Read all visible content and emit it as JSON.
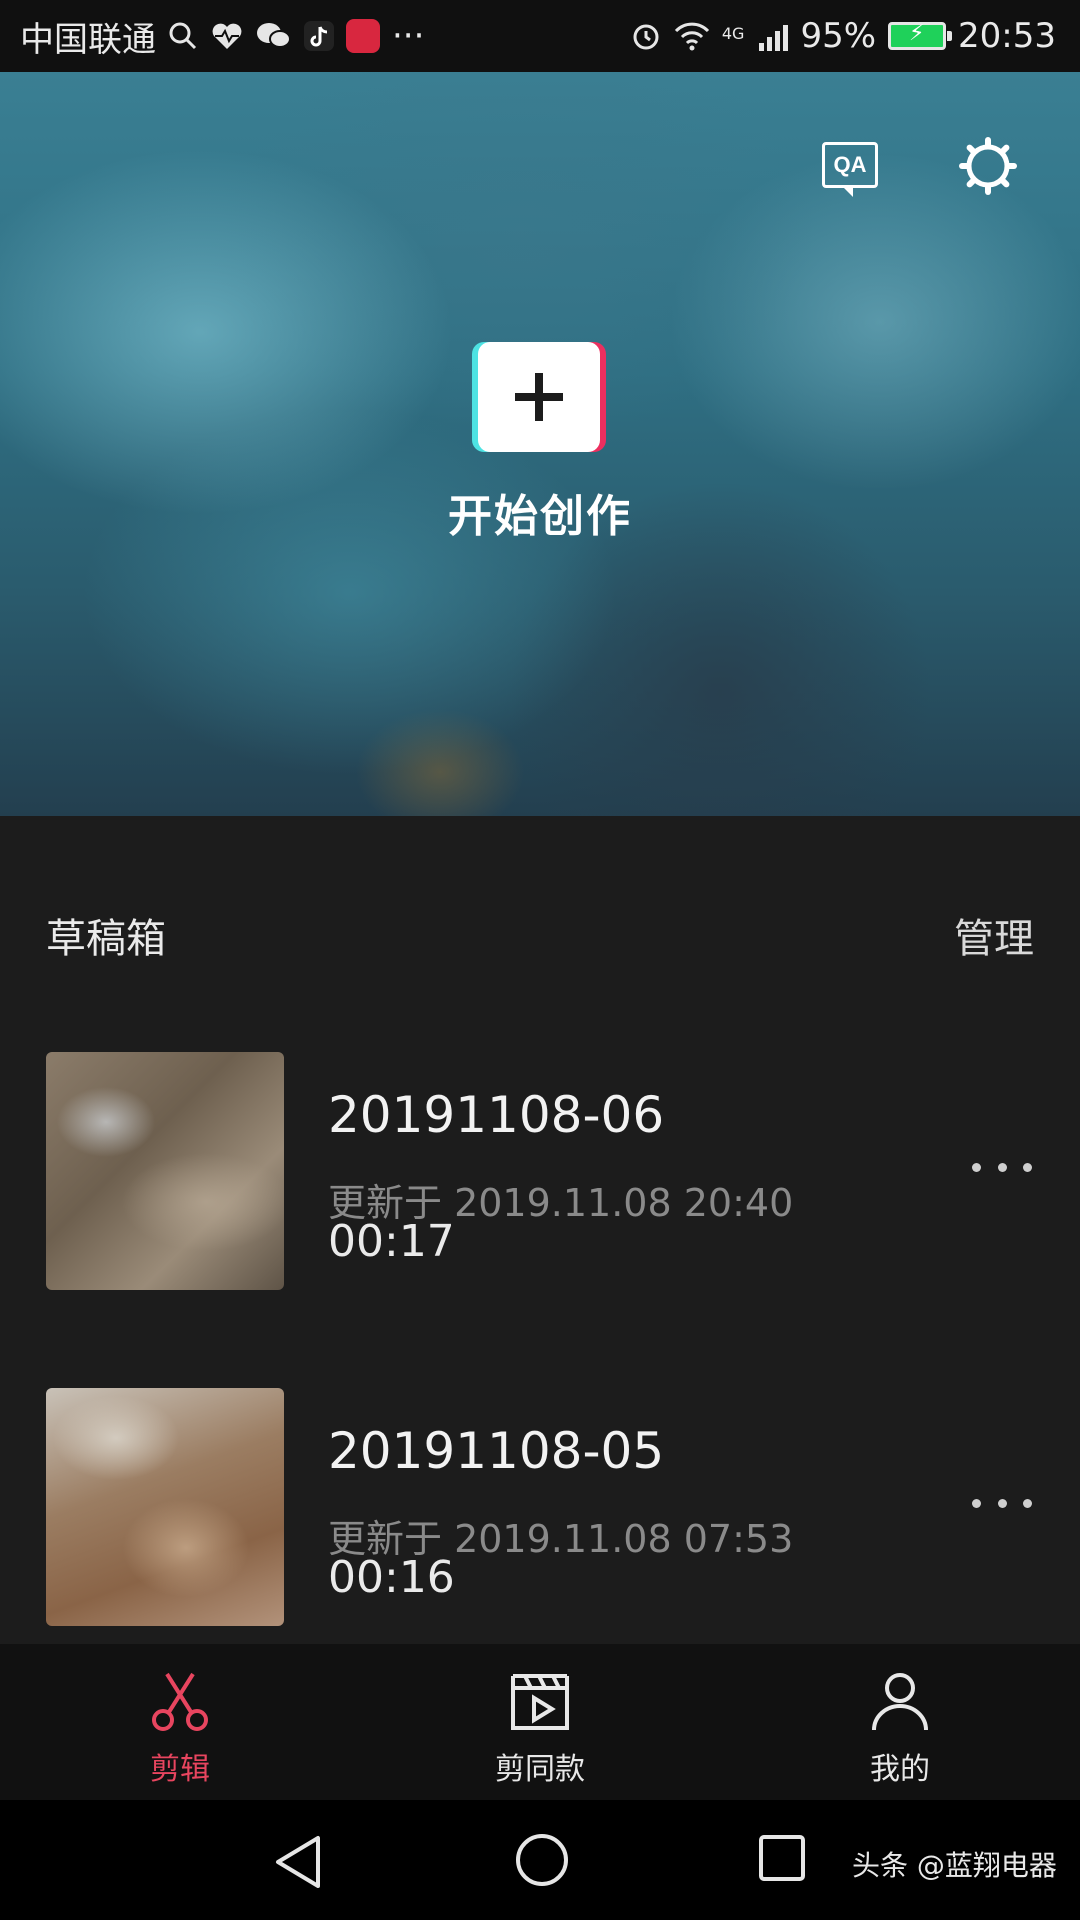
{
  "status_bar": {
    "carrier": "中国联通",
    "network": "4G",
    "battery": "95%",
    "time": "20:53",
    "more": "···"
  },
  "hero": {
    "qa_label": "QA",
    "create_label": "开始创作",
    "create_icon": "plus-icon"
  },
  "drafts": {
    "title": "草稿箱",
    "manage_label": "管理",
    "items": [
      {
        "name": "20191108-06",
        "updated": "更新于 2019.11.08 20:40",
        "duration": "00:17"
      },
      {
        "name": "20191108-05",
        "updated": "更新于 2019.11.08 07:53",
        "duration": "00:16"
      }
    ]
  },
  "tabs": [
    {
      "label": "剪辑",
      "icon": "scissors-icon",
      "active": true
    },
    {
      "label": "剪同款",
      "icon": "clapperboard-icon",
      "active": false
    },
    {
      "label": "我的",
      "icon": "person-icon",
      "active": false
    }
  ],
  "watermark": "头条 @蓝翔电器",
  "colors": {
    "accent": "#e8455f",
    "cyan": "#4ee3e3",
    "pink": "#ec2f5f",
    "panel": "#1c1c1c"
  }
}
